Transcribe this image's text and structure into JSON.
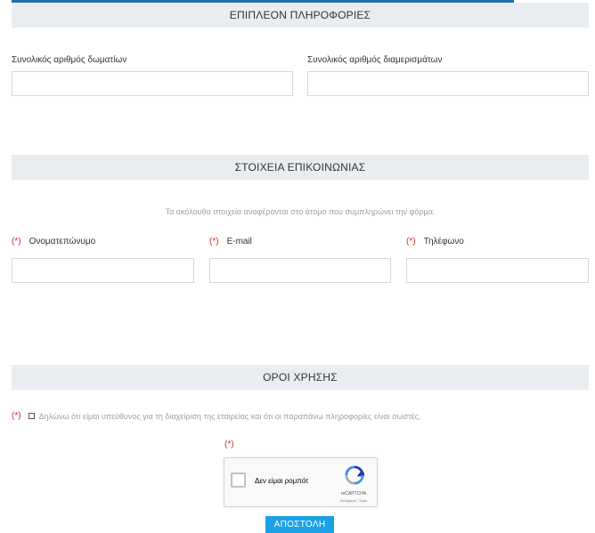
{
  "sections": {
    "extra_info": {
      "title": "ΕΠΙΠΛΕΟΝ ΠΛΗΡΟΦΟΡΙΕΣ"
    },
    "contact": {
      "title": "ΣΤΟΙΧΕΙΑ ΕΠΙΚΟΙΝΩΝΙΑΣ",
      "note": "Τα ακόλουθα στοιχεία αναφέρονται στο άτομο που συμπληρώνει την φόρμα."
    },
    "terms": {
      "title": "ΟΡΟΙ ΧΡΗΣΗΣ"
    }
  },
  "fields": {
    "total_rooms": {
      "label": "Συνολικός αριθμός δωματίων",
      "value": ""
    },
    "total_apartments": {
      "label": "Συνολικός αριθμός διαμερισμάτων",
      "value": ""
    },
    "full_name": {
      "label": "Ονοματεπώνυμο",
      "value": ""
    },
    "email": {
      "label": "E-mail",
      "value": ""
    },
    "phone": {
      "label": "Τηλέφωνο",
      "value": ""
    }
  },
  "required_marker": "(*)",
  "terms_checkbox": {
    "label": "Δηλώνω ότι είμαι υπεύθυνος για τη διαχείριση της εταιρείας και ότι οι παραπάνω πληροφορίες είναι σωστές.",
    "checked": false
  },
  "recaptcha": {
    "label": "Δεν είμαι ρομπότ",
    "brand": "reCAPTCHA",
    "links": "Απόρρητο - Όροι",
    "checked": false
  },
  "submit_label": "ΑΠΟΣΤΟΛΗ",
  "colors": {
    "accent": "#1ca1e6",
    "required": "#d42b2b",
    "header_bg": "#e9edf1"
  }
}
